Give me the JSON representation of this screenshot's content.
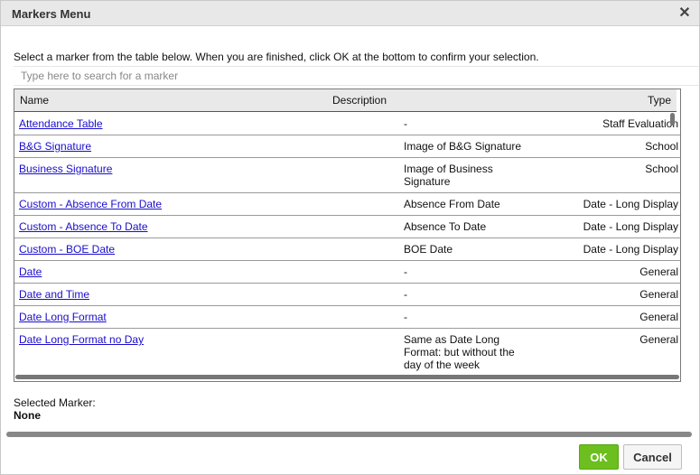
{
  "dialog": {
    "title": "Markers Menu",
    "close_glyph": "✕",
    "instructions": "Select a marker from the table below. When you are finished, click OK at the bottom to confirm your selection.",
    "search_placeholder": "Type here to search for a marker"
  },
  "table": {
    "headers": {
      "name": "Name",
      "description": "Description",
      "type": "Type"
    },
    "rows": [
      {
        "name": "Attendance Table",
        "description": "-",
        "type": "Staff Evaluation"
      },
      {
        "name": "B&G Signature",
        "description": "Image of B&G Signature",
        "type": "School"
      },
      {
        "name": "Business Signature",
        "description": "Image of Business Signature",
        "type": "School"
      },
      {
        "name": "Custom - Absence From Date",
        "description": "Absence From Date",
        "type": "Date - Long Display"
      },
      {
        "name": "Custom - Absence To Date",
        "description": "Absence To Date",
        "type": "Date - Long Display"
      },
      {
        "name": "Custom - BOE Date",
        "description": "BOE Date",
        "type": "Date - Long Display"
      },
      {
        "name": "Date",
        "description": "-",
        "type": "General"
      },
      {
        "name": "Date and Time",
        "description": "-",
        "type": "General"
      },
      {
        "name": "Date Long Format",
        "description": "-",
        "type": "General"
      },
      {
        "name": "Date Long Format no Day",
        "description": "Same as Date Long Format: but without the day of the week",
        "type": "General"
      }
    ]
  },
  "selection": {
    "label": "Selected Marker:",
    "value": "None"
  },
  "buttons": {
    "ok": "OK",
    "cancel": "Cancel"
  }
}
